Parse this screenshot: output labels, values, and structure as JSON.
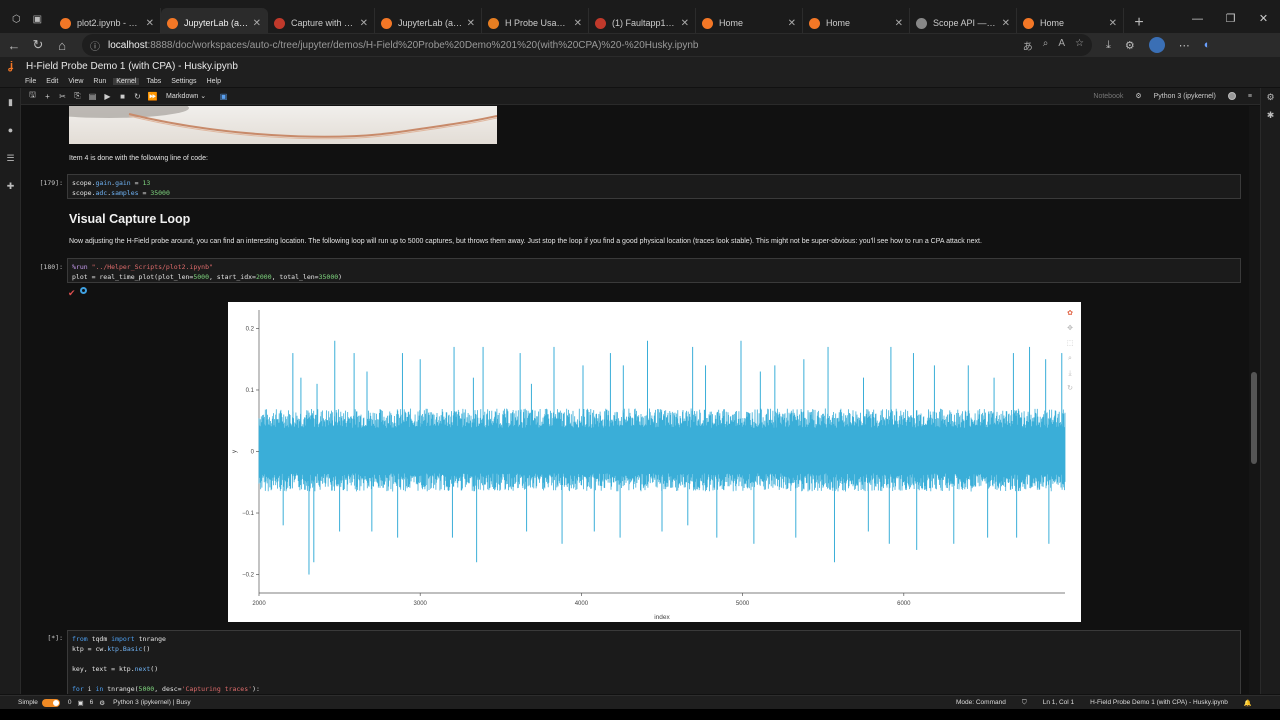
{
  "browser": {
    "tabs": [
      {
        "title": "plot2.ipynb - Jupyte",
        "color": "#f37726"
      },
      {
        "title": "JupyterLab (auto-c",
        "color": "#f37726",
        "active": true
      },
      {
        "title": "Capture with RF pr",
        "color": "#c0392b"
      },
      {
        "title": "JupyterLab (auto-l",
        "color": "#f37726"
      },
      {
        "title": "H Probe Usage - C",
        "color": "#e67e22"
      },
      {
        "title": "(1) Faultapp1 pyth",
        "color": "#c0392b"
      },
      {
        "title": "Home",
        "color": "#f37726"
      },
      {
        "title": "Home",
        "color": "#f37726"
      },
      {
        "title": "Scope API — Chip",
        "color": "#888888"
      },
      {
        "title": "Home",
        "color": "#f37726"
      }
    ],
    "url_host": "localhost",
    "url_path": ":8888/doc/workspaces/auto-c/tree/jupyter/demos/H-Field%20Probe%20Demo%201%20(with%20CPA)%20-%20Husky.ipynb"
  },
  "jupyter": {
    "title": "H-Field Probe Demo 1 (with CPA) - Husky.ipynb",
    "menu": [
      "File",
      "Edit",
      "View",
      "Run",
      "Kernel",
      "Tabs",
      "Settings",
      "Help"
    ],
    "active_menu": "Kernel",
    "cell_type": "Markdown",
    "notebook_label": "Notebook",
    "kernel_name": "Python 3 (ipykernel)"
  },
  "cells": {
    "md1": "Item 4 is done with the following line of code:",
    "c179_prompt": "[179]:",
    "c179_l1_a": "scope.",
    "c179_l1_b": "gain",
    "c179_l1_c": ".",
    "c179_l1_d": "gain",
    "c179_l1_e": " = ",
    "c179_l1_f": "13",
    "c179_l2_a": "scope.",
    "c179_l2_b": "adc",
    "c179_l2_c": ".",
    "c179_l2_d": "samples",
    "c179_l2_e": " = ",
    "c179_l2_f": "35000",
    "heading": "Visual Capture Loop",
    "md2": "Now adjusting the H-Field probe around, you can find an interesting location. The following loop will run up to 5000 captures, but throws them away. Just stop the loop if you find a good physical location (traces look stable). This might not be super-obvious: you'll see how to run a CPA attack next.",
    "c180_prompt": "[180]:",
    "c180_l1_a": "%run ",
    "c180_l1_b": "\"../Helper_Scripts/plot2.ipynb\"",
    "c180_l2_a": "plot = real_time_plot(plot_len=",
    "c180_l2_b": "5000",
    "c180_l2_c": ", start_idx=",
    "c180_l2_d": "2000",
    "c180_l2_e": ", total_len=",
    "c180_l2_f": "35000",
    "c180_l2_g": ")",
    "cstar_prompt": "[*]:",
    "cs_l1_a": "from ",
    "cs_l1_b": "tqdm ",
    "cs_l1_c": "import ",
    "cs_l1_d": "tnrange",
    "cs_l2_a": "ktp = cw.",
    "cs_l2_b": "ktp",
    "cs_l2_c": ".",
    "cs_l2_d": "Basic",
    "cs_l2_e": "()",
    "cs_l3_a": "key, text = ktp.",
    "cs_l3_b": "next",
    "cs_l3_c": "()",
    "cs_l4_a": "for ",
    "cs_l4_b": "i ",
    "cs_l4_c": "in ",
    "cs_l4_d": "tnrange(",
    "cs_l4_e": "5000",
    "cs_l4_f": ", desc=",
    "cs_l4_g": "'Capturing traces'",
    "cs_l4_h": "):"
  },
  "chart_data": {
    "type": "line",
    "xlabel": "index",
    "ylabel": "y",
    "xlim": [
      2000,
      7000
    ],
    "ylim": [
      -0.23,
      0.23
    ],
    "xticks": [
      2000,
      3000,
      4000,
      5000,
      6000
    ],
    "yticks": [
      -0.2,
      -0.1,
      0,
      0.1,
      0.2
    ],
    "xtick_labels": [
      "2000",
      "3000",
      "4000",
      "5000",
      "6000"
    ],
    "ytick_labels": [
      "−0.2",
      "−0.1",
      "0",
      "0.1",
      "0.2"
    ],
    "color": "#3aaed8",
    "band": {
      "low": -0.065,
      "high": 0.07
    },
    "spikes_up": [
      [
        2210,
        0.16
      ],
      [
        2260,
        0.12
      ],
      [
        2360,
        0.11
      ],
      [
        2470,
        0.18
      ],
      [
        2590,
        0.16
      ],
      [
        2670,
        0.13
      ],
      [
        2890,
        0.16
      ],
      [
        3000,
        0.15
      ],
      [
        3210,
        0.17
      ],
      [
        3330,
        0.12
      ],
      [
        3390,
        0.17
      ],
      [
        3620,
        0.16
      ],
      [
        3690,
        0.11
      ],
      [
        3830,
        0.17
      ],
      [
        4010,
        0.14
      ],
      [
        4180,
        0.16
      ],
      [
        4260,
        0.14
      ],
      [
        4410,
        0.18
      ],
      [
        4690,
        0.17
      ],
      [
        4770,
        0.14
      ],
      [
        4990,
        0.18
      ],
      [
        5110,
        0.13
      ],
      [
        5200,
        0.14
      ],
      [
        5380,
        0.15
      ],
      [
        5530,
        0.17
      ],
      [
        5750,
        0.12
      ],
      [
        5920,
        0.17
      ],
      [
        6060,
        0.16
      ],
      [
        6190,
        0.14
      ],
      [
        6400,
        0.14
      ],
      [
        6560,
        0.12
      ],
      [
        6680,
        0.16
      ],
      [
        6780,
        0.17
      ],
      [
        6880,
        0.15
      ],
      [
        6980,
        0.16
      ]
    ],
    "spikes_down": [
      [
        2150,
        -0.12
      ],
      [
        2310,
        -0.2
      ],
      [
        2340,
        -0.18
      ],
      [
        2500,
        -0.13
      ],
      [
        2700,
        -0.13
      ],
      [
        2860,
        -0.14
      ],
      [
        3200,
        -0.14
      ],
      [
        3350,
        -0.18
      ],
      [
        3660,
        -0.13
      ],
      [
        3880,
        -0.15
      ],
      [
        4080,
        -0.13
      ],
      [
        4240,
        -0.14
      ],
      [
        4500,
        -0.13
      ],
      [
        4660,
        -0.12
      ],
      [
        4840,
        -0.14
      ],
      [
        5070,
        -0.15
      ],
      [
        5330,
        -0.14
      ],
      [
        5570,
        -0.18
      ],
      [
        5780,
        -0.13
      ],
      [
        5910,
        -0.15
      ],
      [
        6080,
        -0.16
      ],
      [
        6310,
        -0.15
      ],
      [
        6520,
        -0.14
      ],
      [
        6700,
        -0.14
      ],
      [
        6900,
        -0.15
      ]
    ]
  },
  "status": {
    "mode_label": "Simple",
    "counts_a": "0",
    "counts_b": "6",
    "kernel_status": "Python 3 (ipykernel) | Busy",
    "mode": "Mode: Command",
    "position": "Ln 1, Col 1",
    "file": "H-Field Probe Demo 1 (with CPA) - Husky.ipynb"
  }
}
